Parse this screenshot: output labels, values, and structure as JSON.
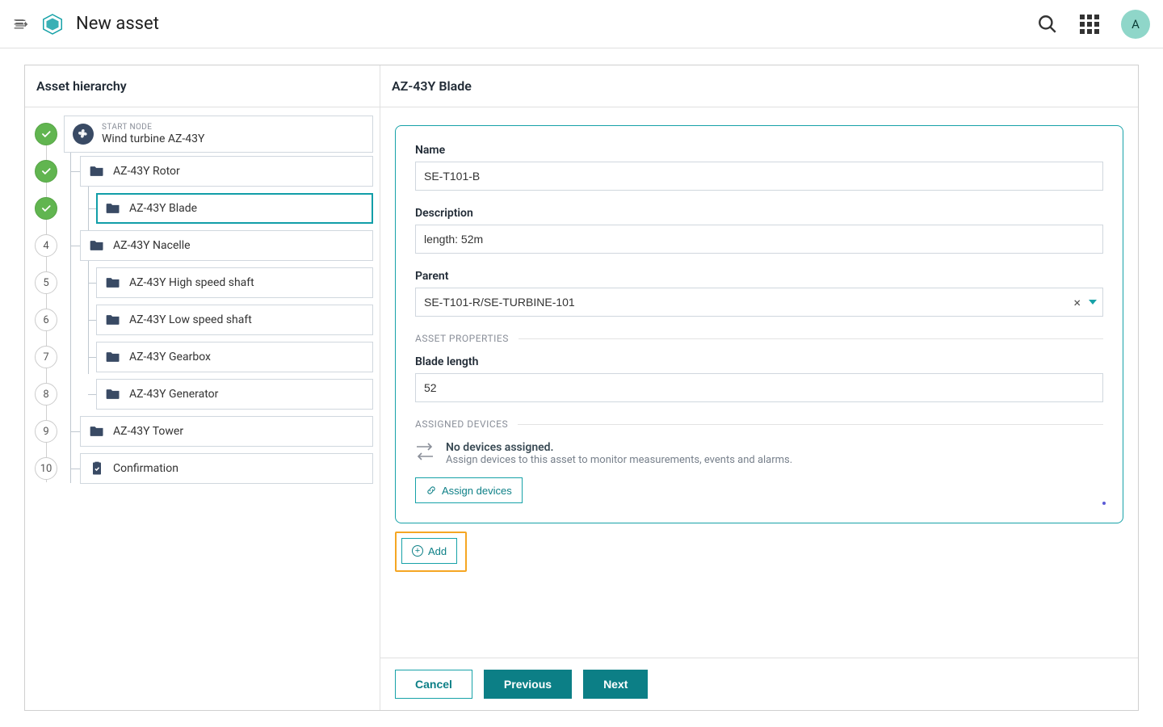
{
  "header": {
    "title": "New asset",
    "avatar_initial": "A"
  },
  "sidebar": {
    "title": "Asset hierarchy",
    "steps": [
      {
        "status": "done",
        "overline": "START NODE",
        "label": "Wind turbine AZ-43Y",
        "icon": "fan",
        "indent": 0
      },
      {
        "status": "done",
        "label": "AZ-43Y Rotor",
        "icon": "folder",
        "indent": 1
      },
      {
        "status": "done",
        "label": "AZ-43Y Blade",
        "icon": "folder",
        "indent": 2,
        "active": true
      },
      {
        "status": "4",
        "label": "AZ-43Y Nacelle",
        "icon": "folder",
        "indent": 1
      },
      {
        "status": "5",
        "label": "AZ-43Y High speed shaft",
        "icon": "folder",
        "indent": 2
      },
      {
        "status": "6",
        "label": "AZ-43Y Low speed shaft",
        "icon": "folder",
        "indent": 2
      },
      {
        "status": "7",
        "label": "AZ-43Y Gearbox",
        "icon": "folder",
        "indent": 2
      },
      {
        "status": "8",
        "label": "AZ-43Y Generator",
        "icon": "folder",
        "indent": 2
      },
      {
        "status": "9",
        "label": "AZ-43Y Tower",
        "icon": "folder",
        "indent": 1
      },
      {
        "status": "10",
        "label": "Confirmation",
        "icon": "clip",
        "indent": 1
      }
    ]
  },
  "form": {
    "title": "AZ-43Y Blade",
    "name_label": "Name",
    "name_value": "SE-T101-B",
    "desc_label": "Description",
    "desc_value": "length: 52m",
    "parent_label": "Parent",
    "parent_value": "SE-T101-R/SE-TURBINE-101",
    "props_header": "ASSET PROPERTIES",
    "prop1_label": "Blade length",
    "prop1_value": "52",
    "devices_header": "ASSIGNED DEVICES",
    "no_dev_title": "No devices assigned.",
    "no_dev_sub": "Assign devices to this asset to monitor measurements, events and alarms.",
    "assign_btn": "Assign devices",
    "add_btn": "Add"
  },
  "footer": {
    "cancel": "Cancel",
    "previous": "Previous",
    "next": "Next"
  }
}
